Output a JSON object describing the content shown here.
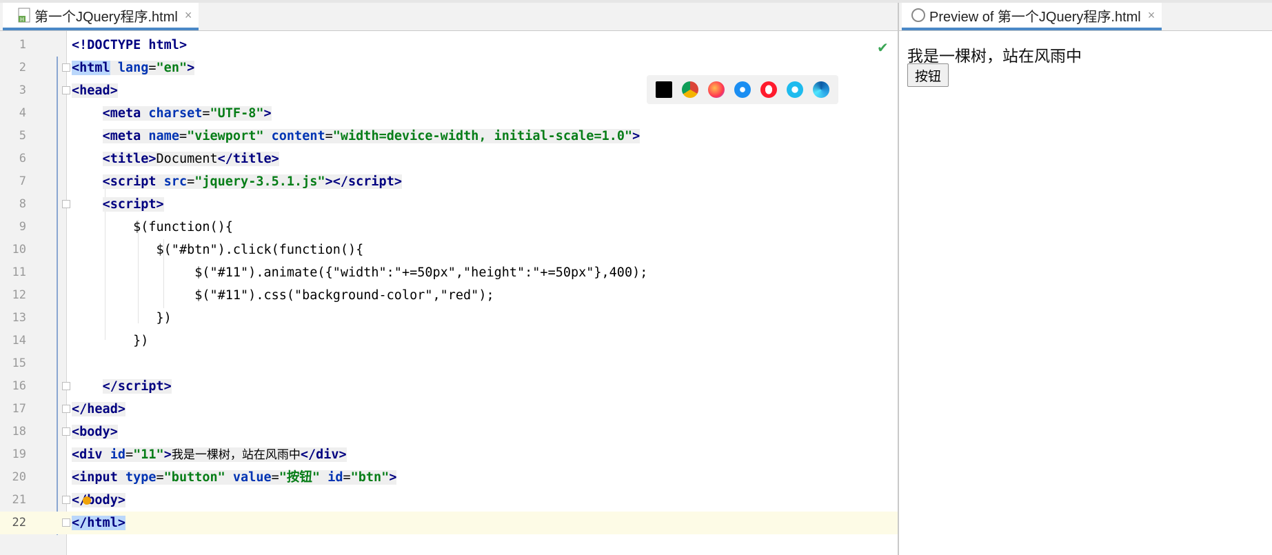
{
  "editor": {
    "tab_title": "第一个JQuery程序.html",
    "tab_close": "×",
    "status_check": "✔",
    "lines": [
      "1",
      "2",
      "3",
      "4",
      "5",
      "6",
      "7",
      "8",
      "9",
      "10",
      "11",
      "12",
      "13",
      "14",
      "15",
      "16",
      "17",
      "18",
      "19",
      "20",
      "21",
      "22"
    ],
    "browser_icons": [
      "intellij-icon",
      "chrome-icon",
      "firefox-icon",
      "safari-icon",
      "opera-icon",
      "ie-icon",
      "edge-icon"
    ]
  },
  "code": {
    "l1": "<!DOCTYPE html>",
    "l6_title": "Document",
    "l9": "$(function(){",
    "l10": "$(\"#btn\").click(function(){",
    "l11": "$(\"#11\").animate({\"width\":\"+=50px\",\"height\":\"+=50px\"},400);",
    "l12": "$(\"#11\").css(\"background-color\",\"red\");",
    "l13": "})",
    "l14": "})",
    "l19_text": "我是一棵树，站在风雨中",
    "l20_value": "按钮"
  },
  "preview": {
    "tab_title": "Preview of 第一个JQuery程序.html",
    "tab_close": "×",
    "div_text": "我是一棵树，站在风雨中",
    "button_label": "按钮"
  }
}
